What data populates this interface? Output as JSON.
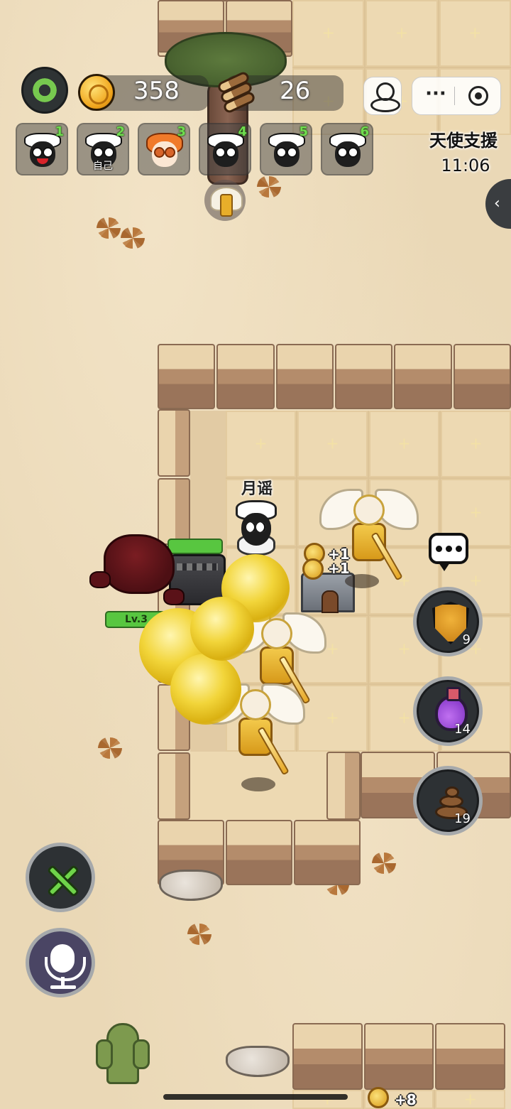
{
  "hud": {
    "coins": "358",
    "wood": "26",
    "menu_dots": "···"
  },
  "players": [
    {
      "num": "1",
      "tag": ""
    },
    {
      "num": "2",
      "tag": "自己"
    },
    {
      "num": "3",
      "tag": ""
    },
    {
      "num": "4",
      "tag": ""
    },
    {
      "num": "5",
      "tag": ""
    },
    {
      "num": "6",
      "tag": ""
    }
  ],
  "support": {
    "label": "天使支援",
    "timer": "11:06"
  },
  "side_tab_arrow": "‹",
  "scene": {
    "player_name": "月谣",
    "enemy_level": "Lv.3",
    "coin_gain_1": "+1",
    "coin_gain_2": "+1",
    "coin_gain_bottom": "+8"
  },
  "items": {
    "shield_count": "9",
    "potion_count": "14",
    "poop_count": "19"
  },
  "icons": {
    "settings": "gear-icon",
    "coin": "coin-icon",
    "wood": "wood-icon",
    "joystick": "joystick-icon",
    "more": "more-dots-icon",
    "target": "target-icon",
    "chat": "chat-bubble-icon",
    "shield": "shield-icon",
    "potion": "potion-icon",
    "poop": "poop-icon",
    "build": "tools-icon",
    "voice": "microphone-icon"
  },
  "colors": {
    "accent_green": "#6fd44a",
    "hud_dark": "#2d3134",
    "sand": "#ead8b6"
  }
}
